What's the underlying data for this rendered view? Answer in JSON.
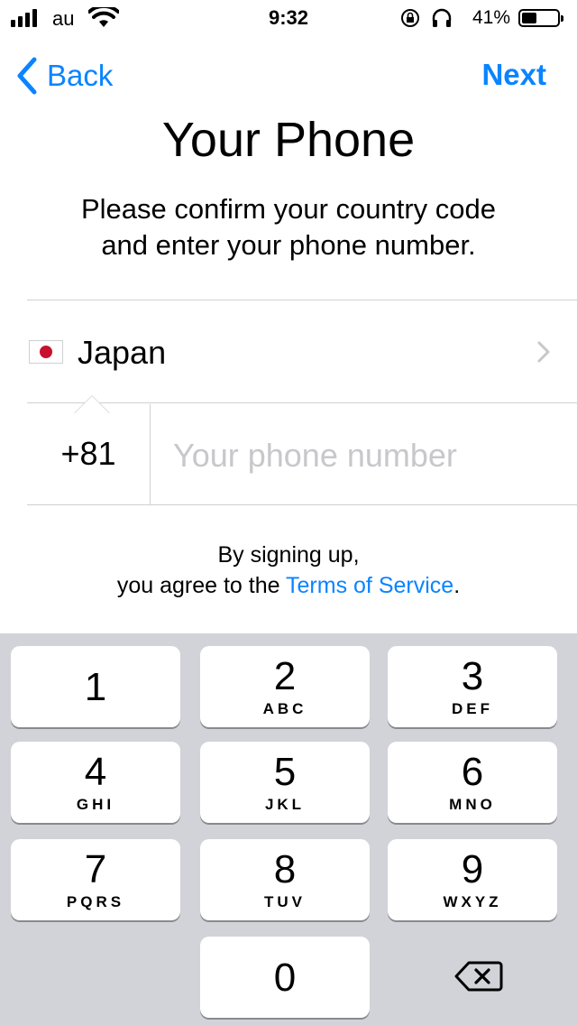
{
  "status_bar": {
    "carrier": "au",
    "time": "9:32",
    "battery_percent": "41%",
    "battery_level": 0.41
  },
  "nav": {
    "back_label": "Back",
    "next_label": "Next"
  },
  "title": "Your Phone",
  "subtitle_line1": "Please confirm your country code",
  "subtitle_line2": "and enter your phone number.",
  "country": {
    "flag_icon": "japan-flag-icon",
    "name": "Japan"
  },
  "phone": {
    "country_code": "+81",
    "value": "",
    "placeholder": "Your phone number"
  },
  "terms": {
    "line1": "By signing up,",
    "line2_prefix": "you agree to the ",
    "link": "Terms of Service",
    "line2_suffix": "."
  },
  "keypad": {
    "keys": [
      {
        "digit": "1",
        "letters": ""
      },
      {
        "digit": "2",
        "letters": "ABC"
      },
      {
        "digit": "3",
        "letters": "DEF"
      },
      {
        "digit": "4",
        "letters": "GHI"
      },
      {
        "digit": "5",
        "letters": "JKL"
      },
      {
        "digit": "6",
        "letters": "MNO"
      },
      {
        "digit": "7",
        "letters": "PQRS"
      },
      {
        "digit": "8",
        "letters": "TUV"
      },
      {
        "digit": "9",
        "letters": "WXYZ"
      },
      {
        "digit": "0",
        "letters": ""
      }
    ],
    "delete_icon": "backspace-icon"
  },
  "colors": {
    "accent": "#0a84ff",
    "keypad_bg": "#d1d3d9",
    "placeholder": "#c7c7cc"
  }
}
